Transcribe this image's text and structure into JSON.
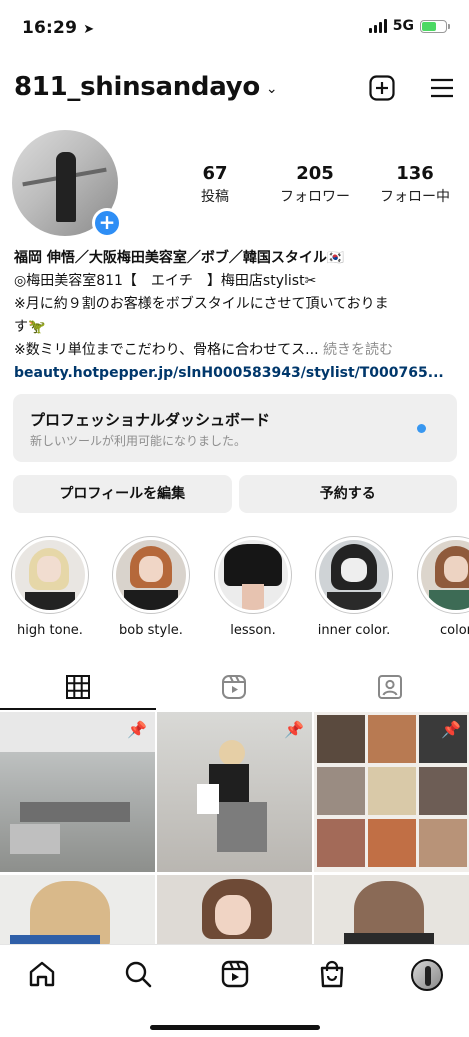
{
  "status_bar": {
    "time": "16:29",
    "network": "5G",
    "icons": [
      "location-arrow-icon",
      "signal-icon",
      "battery-charging-icon"
    ]
  },
  "header": {
    "username": "811_shinsandayo",
    "icons": [
      "chevron-down-icon",
      "new-post-icon",
      "menu-icon"
    ]
  },
  "profile": {
    "stats": [
      {
        "value": "67",
        "label": "投稿"
      },
      {
        "value": "205",
        "label": "フォロワー"
      },
      {
        "value": "136",
        "label": "フォロー中"
      }
    ],
    "bio": {
      "name": "福岡 伸悟／大阪梅田美容室／ボブ／韓国スタイル🇰🇷",
      "line1": "◎梅田美容室811【　エイチ　】梅田店stylist✂",
      "line2": "※月に約９割のお客様をボブスタイルにさせて頂いておりま",
      "line3": "す🦖",
      "line4": "※数ミリ単位までこだわり、骨格に合わせてス...",
      "more": " 続きを読む",
      "link": "beauty.hotpepper.jp/slnH000583943/stylist/T000765..."
    }
  },
  "dashboard": {
    "title": "プロフェッショナルダッシュボード",
    "subtitle": "新しいツールが利用可能になりました。",
    "dot_color": "#3897f0"
  },
  "buttons": {
    "edit_profile": "プロフィールを編集",
    "reserve": "予約する"
  },
  "highlights": [
    {
      "label": "high tone."
    },
    {
      "label": "bob style."
    },
    {
      "label": "lesson."
    },
    {
      "label": "inner color."
    },
    {
      "label": "color"
    }
  ],
  "tabs": [
    "grid-icon",
    "reels-icon",
    "tagged-icon"
  ],
  "bottom_nav": [
    "home-icon",
    "search-icon",
    "reels-icon",
    "shop-icon",
    "profile-avatar"
  ],
  "colors": {
    "accent": "#2e8ef5",
    "link": "#00376b",
    "muted": "#8e8e8e",
    "surface": "#efefef"
  }
}
